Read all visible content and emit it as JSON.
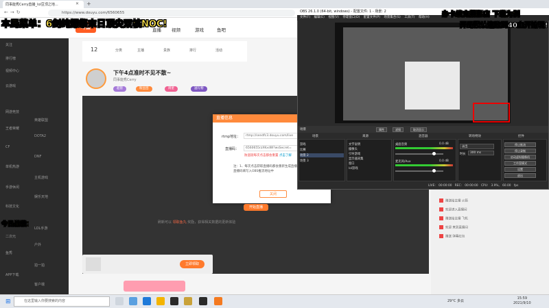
{
  "browser": {
    "tab_title": "同事能秀Cerry直播_lol豆顶之地...",
    "url": "https://www.douyu.com/6560655"
  },
  "overlay": {
    "top_left": "本局菜单：6剑纯爆祭末日顶尖双核NOC!",
    "bottom_left": "今日战绩：",
    "top_right_1": "办卡续充摄影店 下载为例",
    "top_right_2": "开局默认连败到40血开始玩!"
  },
  "douyu": {
    "logo": "斗鱼",
    "nav": [
      "直播",
      "视频",
      "游戏",
      "鱼吧"
    ],
    "room": {
      "title": "下午4点准时不见不散~",
      "meta": "同事能秀Cerry",
      "tags": [
        "超管",
        "粉丝团",
        "周星",
        "送礼物"
      ]
    },
    "stats": [
      "12",
      "分类",
      "主播",
      "贵族",
      "排行",
      "活动"
    ],
    "sidebar": [
      "关注",
      "排行榜",
      "视频中心",
      "云游戏",
      "网游竞技",
      "英雄联盟",
      "王者荣耀",
      "DOTA2",
      "CF",
      "DNF",
      "单机热游",
      "主机游戏",
      "手游休闲",
      "娱乐天地",
      "科技文化",
      "LOL手游",
      "二次元",
      "户外",
      "鱼秀",
      "拍一拍",
      "APP下载",
      "客户端"
    ],
    "bottom_text": "刷新可以",
    "bottom_link": "领取鱼丸",
    "bottom_text_2": "奖励，获得相关数据的更新体验"
  },
  "dialog": {
    "title": "直播信息",
    "rtmp_label": "rtmp地址：",
    "rtmp_value": "rtmp://sendfc3.douyu.com/live",
    "key_label": "直播码：",
    "key_value": "6560655rzXKxdW?wsSecret=",
    "warn": "防盗链每次点击都会重置",
    "warn_link": "点击了解",
    "note": "注：1、每次点击获取直播码都会重新生成直播码的...2、开播后请将直播码填写入OBS推流地址中",
    "close_button": "关闭",
    "action_button": "开始直播"
  },
  "gift": {
    "button": "立即领取"
  },
  "chat": {
    "lines": [
      "赠送给主播 火箭",
      "欢迎进入直播间",
      "赠送给主播 飞机",
      "欢迎 来到直播间",
      "赠送 弹幕红包"
    ]
  },
  "obs": {
    "title": "OBS 26.1.0 (64-bit, windows) - 配置文件: 1 - 场景: 2",
    "menu": "文件(F) 编辑(E) 视图(V) 停靠窗口(D) 配置文件(P) 场景集合(S) 工具(T) 帮助(H)",
    "bar_label": "场景",
    "bar_buttons": [
      "属性",
      "滤镜",
      "取消显示"
    ],
    "docks": {
      "scenes": "场景",
      "sources": "来源",
      "mixer": "混音器",
      "transitions": "转场特效",
      "controls": "控件"
    },
    "scenes": [
      "游戏",
      "比赛",
      "场景 2",
      "场景 3"
    ],
    "sources": [
      "文字说明",
      "摄像头",
      "引导游戏",
      "显示器采集",
      "窗口",
      "lol游戏"
    ],
    "mixer": [
      {
        "name": "桌面音频",
        "db": "0.0 dB"
      },
      {
        "name": "麦克风/Aux",
        "db": "0.0 dB"
      }
    ],
    "transition": {
      "type": "淡出",
      "duration_label": "时长",
      "duration": "300 ms"
    },
    "controls": [
      "停止推流",
      "停止录制",
      "启动虚拟摄像机",
      "工作室模式",
      "设置",
      "退出"
    ],
    "status": "LIVE: 00:00:00  REC: 00:00:00  CPU: 3.9%, 60.00 fps"
  },
  "taskbar": {
    "search": "在这里输入你要搜索的内容",
    "weather": "29°C 多云",
    "time": "15:59",
    "date": "2021/9/10"
  }
}
